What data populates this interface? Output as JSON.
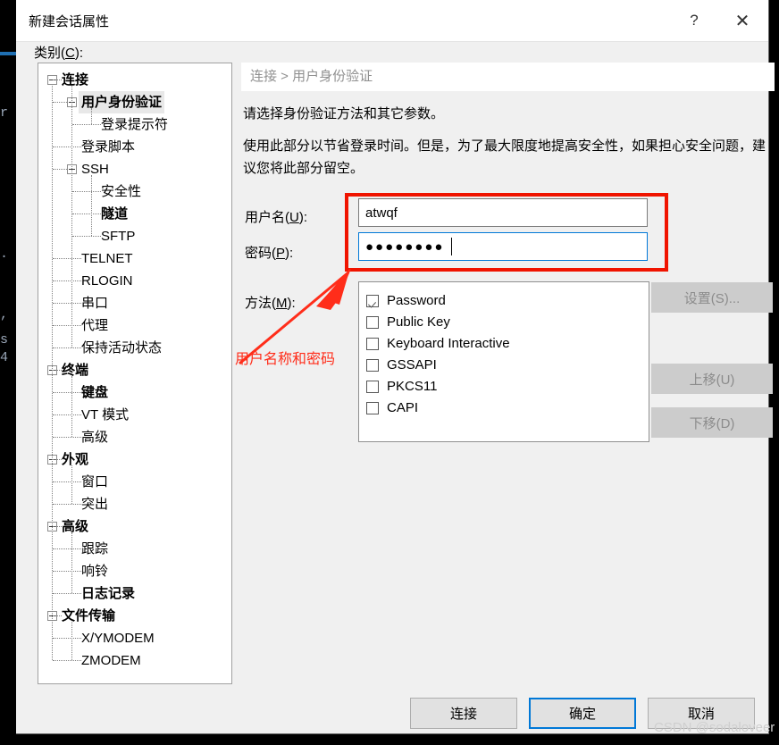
{
  "window": {
    "title": "新建会话属性",
    "help_button": "?",
    "close_button": "✕",
    "category_label_prefix": "类别(",
    "category_label_key": "C",
    "category_label_suffix": "):"
  },
  "background_terminal": {
    "lines": [
      "r",
      ".",
      ",",
      "s",
      "4"
    ],
    "accent_color": "#1f6fb2",
    "background_color": "#000000"
  },
  "tree": {
    "nodes": [
      {
        "label": "连接",
        "level": 0,
        "expandable": true,
        "bold": true,
        "selected": false
      },
      {
        "label": "用户身份验证",
        "level": 1,
        "expandable": true,
        "bold": true,
        "selected": true
      },
      {
        "label": "登录提示符",
        "level": 2,
        "expandable": false,
        "bold": false,
        "selected": false
      },
      {
        "label": "登录脚本",
        "level": 1,
        "expandable": false,
        "bold": false,
        "selected": false
      },
      {
        "label": "SSH",
        "level": 1,
        "expandable": true,
        "bold": false,
        "selected": false
      },
      {
        "label": "安全性",
        "level": 2,
        "expandable": false,
        "bold": false,
        "selected": false
      },
      {
        "label": "隧道",
        "level": 2,
        "expandable": false,
        "bold": true,
        "selected": false
      },
      {
        "label": "SFTP",
        "level": 2,
        "expandable": false,
        "bold": false,
        "selected": false
      },
      {
        "label": "TELNET",
        "level": 1,
        "expandable": false,
        "bold": false,
        "selected": false
      },
      {
        "label": "RLOGIN",
        "level": 1,
        "expandable": false,
        "bold": false,
        "selected": false
      },
      {
        "label": "串口",
        "level": 1,
        "expandable": false,
        "bold": false,
        "selected": false
      },
      {
        "label": "代理",
        "level": 1,
        "expandable": false,
        "bold": false,
        "selected": false
      },
      {
        "label": "保持活动状态",
        "level": 1,
        "expandable": false,
        "bold": false,
        "selected": false
      },
      {
        "label": "终端",
        "level": 0,
        "expandable": true,
        "bold": true,
        "selected": false
      },
      {
        "label": "键盘",
        "level": 1,
        "expandable": false,
        "bold": true,
        "selected": false
      },
      {
        "label": "VT 模式",
        "level": 1,
        "expandable": false,
        "bold": false,
        "selected": false
      },
      {
        "label": "高级",
        "level": 1,
        "expandable": false,
        "bold": false,
        "selected": false
      },
      {
        "label": "外观",
        "level": 0,
        "expandable": true,
        "bold": true,
        "selected": false
      },
      {
        "label": "窗口",
        "level": 1,
        "expandable": false,
        "bold": false,
        "selected": false
      },
      {
        "label": "突出",
        "level": 1,
        "expandable": false,
        "bold": false,
        "selected": false
      },
      {
        "label": "高级",
        "level": 0,
        "expandable": true,
        "bold": true,
        "selected": false
      },
      {
        "label": "跟踪",
        "level": 1,
        "expandable": false,
        "bold": false,
        "selected": false
      },
      {
        "label": "响铃",
        "level": 1,
        "expandable": false,
        "bold": false,
        "selected": false
      },
      {
        "label": "日志记录",
        "level": 1,
        "expandable": false,
        "bold": true,
        "selected": false
      },
      {
        "label": "文件传输",
        "level": 0,
        "expandable": true,
        "bold": true,
        "selected": false
      },
      {
        "label": "X/YMODEM",
        "level": 1,
        "expandable": false,
        "bold": false,
        "selected": false
      },
      {
        "label": "ZMODEM",
        "level": 1,
        "expandable": false,
        "bold": false,
        "selected": false
      }
    ]
  },
  "main": {
    "breadcrumb": "连接 > 用户身份验证",
    "description_1": "请选择身份验证方法和其它参数。",
    "description_2": "使用此部分以节省登录时间。但是，为了最大限度地提高安全性，如果担心安全问题，建议您将此部分留空。",
    "username": {
      "label_prefix": "用户名(",
      "label_key": "U",
      "label_suffix": "):",
      "value": "atwqf"
    },
    "password": {
      "label_prefix": "密码(",
      "label_key": "P",
      "label_suffix": "):",
      "value": "●●●●●●●●"
    },
    "method": {
      "label_prefix": "方法(",
      "label_key": "M",
      "label_suffix": "):",
      "items": [
        {
          "label": "Password",
          "checked": true
        },
        {
          "label": "Public Key",
          "checked": false
        },
        {
          "label": "Keyboard Interactive",
          "checked": false
        },
        {
          "label": "GSSAPI",
          "checked": false
        },
        {
          "label": "PKCS11",
          "checked": false
        },
        {
          "label": "CAPI",
          "checked": false
        }
      ]
    },
    "side_buttons": [
      {
        "label": "设置(S)...",
        "enabled": false
      },
      {
        "label": "上移(U)",
        "enabled": false
      },
      {
        "label": "下移(D)",
        "enabled": false
      }
    ]
  },
  "footer": {
    "connect_label": "连接",
    "ok_label": "确定",
    "cancel_label": "取消"
  },
  "annotations": {
    "highlight_text": "用户名称和密码",
    "highlight_color": "#f01400",
    "arrow_color": "#ff2d1a"
  },
  "watermark": "CSDN @sodaloveer"
}
